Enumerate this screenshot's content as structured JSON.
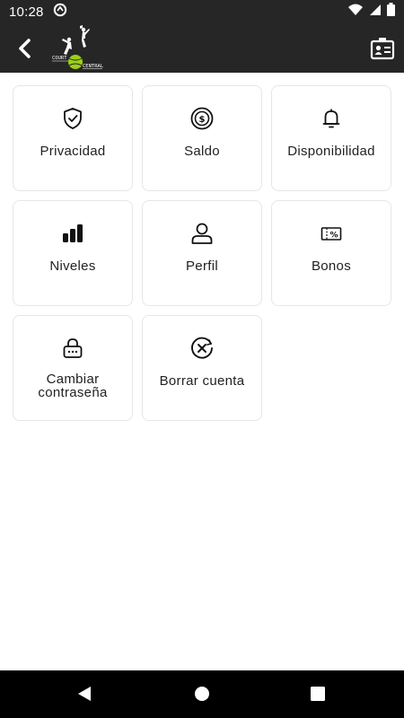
{
  "status_bar": {
    "time": "10:28"
  },
  "app_bar": {
    "brand_top": "COURT",
    "brand_bottom": "CENTRAL",
    "accent_color": "#9ccf16",
    "background_color": "#262626"
  },
  "menu": [
    {
      "label": "Privacidad",
      "icon": "shield-check-icon"
    },
    {
      "label": "Saldo",
      "icon": "coin-icon"
    },
    {
      "label": "Disponibilidad",
      "icon": "bell-icon"
    },
    {
      "label": "Niveles",
      "icon": "bar-levels-icon"
    },
    {
      "label": "Perfil",
      "icon": "user-icon"
    },
    {
      "label": "Bonos",
      "icon": "ticket-percent-icon"
    },
    {
      "label_line1": "Cambiar",
      "label_line2": "contraseña",
      "icon": "lock-password-icon"
    },
    {
      "label": "Borrar cuenta",
      "icon": "delete-circle-icon"
    }
  ]
}
